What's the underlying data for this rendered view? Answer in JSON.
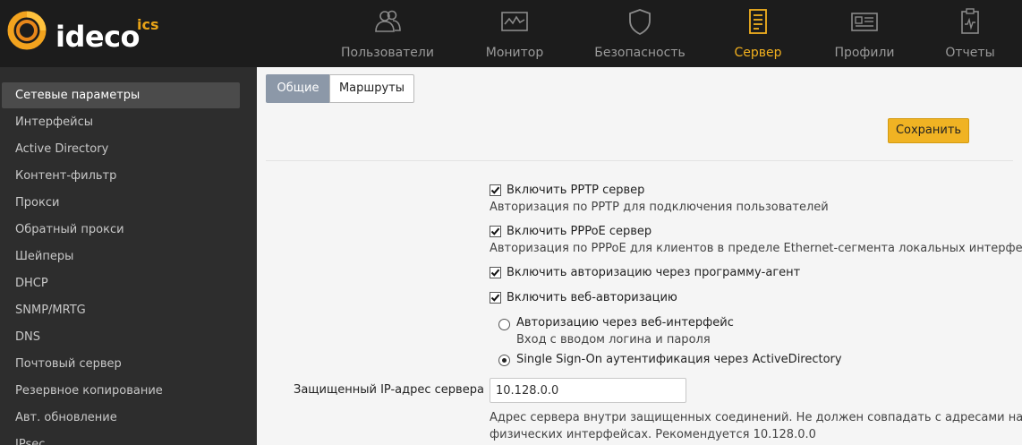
{
  "brand": {
    "name": "ideco",
    "suffix": "ics",
    "accent_color": "#f2b01e"
  },
  "nav": {
    "items": [
      {
        "label": "Пользователи",
        "icon": "users-icon"
      },
      {
        "label": "Монитор",
        "icon": "monitor-icon"
      },
      {
        "label": "Безопасность",
        "icon": "shield-icon"
      },
      {
        "label": "Сервер",
        "icon": "server-icon",
        "active": true
      },
      {
        "label": "Профили",
        "icon": "id-card-icon"
      },
      {
        "label": "Отчеты",
        "icon": "report-icon"
      }
    ]
  },
  "sidebar": {
    "items": [
      {
        "label": "Сетевые параметры",
        "active": true
      },
      {
        "label": "Интерфейсы"
      },
      {
        "label": "Active Directory"
      },
      {
        "label": "Контент-фильтр"
      },
      {
        "label": "Прокси"
      },
      {
        "label": "Обратный прокси"
      },
      {
        "label": "Шейперы"
      },
      {
        "label": "DHCP"
      },
      {
        "label": "SNMP/MRTG"
      },
      {
        "label": "DNS"
      },
      {
        "label": "Почтовый сервер"
      },
      {
        "label": "Резервное копирование"
      },
      {
        "label": "Авт. обновление"
      },
      {
        "label": "IPsec"
      }
    ]
  },
  "tabs": [
    {
      "label": "Общие",
      "active": true
    },
    {
      "label": "Маршруты"
    }
  ],
  "toolbar": {
    "save_label": "Сохранить"
  },
  "settings": {
    "pptp": {
      "label": "Включить PPTP сервер",
      "checked": true,
      "hint": "Авторизация по PPTP для подключения пользователей"
    },
    "pppoe": {
      "label": "Включить PPPoE сервер",
      "checked": true,
      "hint": "Авторизация по PPPoE для клиентов в пределе Ethernet-сегмента локальных интерфейсов"
    },
    "agent": {
      "label": "Включить авторизацию через программу-агент",
      "checked": true
    },
    "web": {
      "label": "Включить веб-авторизацию",
      "checked": true
    },
    "web_mode": {
      "options": [
        {
          "label": "Авторизацию через веб-интерфейс",
          "hint": "Вход с вводом логина и пароля",
          "selected": false
        },
        {
          "label": "Single Sign-On аутентификация через ActiveDirectory",
          "selected": true
        }
      ]
    },
    "secure_ip": {
      "label": "Защищенный IP-адрес сервера",
      "value": "10.128.0.0",
      "hint_line1": "Адрес сервера внутри защищенных соединений. Не должен совпадать с адресами на",
      "hint_line2": "физических интерфейсах. Рекомендуется 10.128.0.0"
    }
  }
}
